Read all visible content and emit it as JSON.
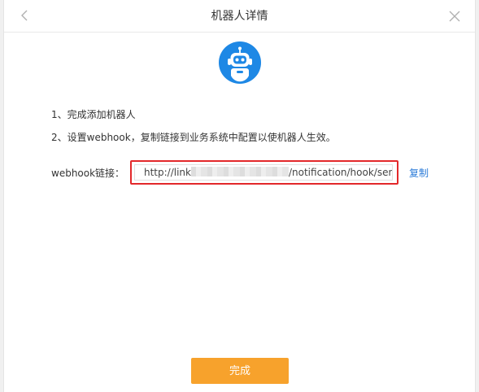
{
  "dialog": {
    "title": "机器人详情",
    "back_icon": "chevron-left-icon",
    "close_icon": "close-icon"
  },
  "robot": {
    "icon": "robot-icon",
    "colors": {
      "circle": "#1e88e5",
      "face": "#ffffff"
    }
  },
  "steps": [
    "1、完成添加机器人",
    "2、设置webhook，复制链接到业务系统中配置以使机器人生效。"
  ],
  "webhook": {
    "label": "webhook链接：",
    "url_prefix": "http://link",
    "url_suffix": "/notification/hook/send",
    "copy_label": "复制"
  },
  "footer": {
    "done_label": "完成"
  },
  "colors": {
    "accent_orange": "#f7a22c",
    "highlight_red": "#e3282a",
    "link_blue": "#2b7bd8"
  }
}
